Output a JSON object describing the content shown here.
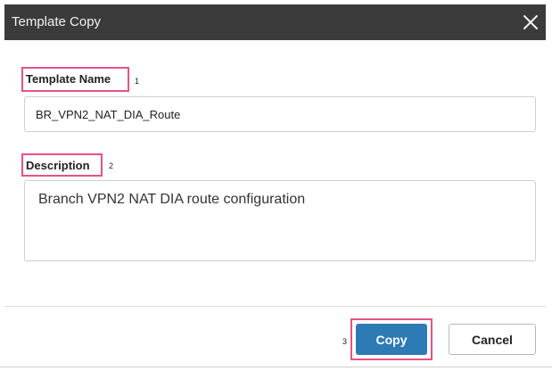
{
  "dialog": {
    "title": "Template Copy",
    "close_icon": "close-icon"
  },
  "fields": {
    "template_name": {
      "label": "Template Name",
      "callout_number": "1",
      "value": "BR_VPN2_NAT_DIA_Route"
    },
    "description": {
      "label": "Description",
      "callout_number": "2",
      "value": "Branch VPN2 NAT DIA route configuration"
    }
  },
  "footer": {
    "copy_callout_number": "3",
    "copy_label": "Copy",
    "cancel_label": "Cancel"
  },
  "colors": {
    "titlebar": "#3b3b3b",
    "callout_border": "#e8508a",
    "primary_button": "#2e7ab5"
  }
}
